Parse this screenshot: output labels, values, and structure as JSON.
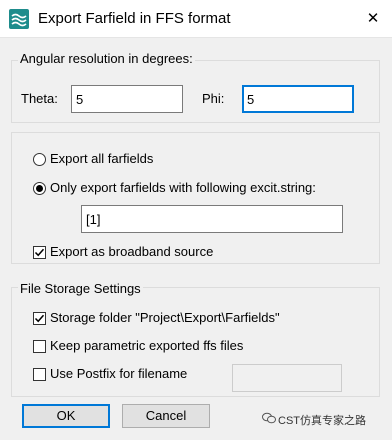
{
  "window": {
    "title": "Export Farfield in FFS format",
    "close_glyph": "✕",
    "icon": "cst-waves-icon"
  },
  "angular": {
    "group_label": "Angular resolution in degrees:",
    "theta_label": "Theta:",
    "theta_value": "5",
    "phi_label": "Phi:",
    "phi_value": "5"
  },
  "export": {
    "all_label": "Export all farfields",
    "only_label": "Only export farfields with following excit.string:",
    "excit_value": "[1]",
    "broadband_label": "Export as broadband source"
  },
  "storage": {
    "group_label": "File Storage Settings",
    "folder_label": "Storage folder \"Project\\Export\\Farfields\"",
    "keep_label": "Keep parametric exported ffs files",
    "postfix_label": "Use Postfix for filename",
    "postfix_value": ""
  },
  "buttons": {
    "ok_label": "OK",
    "cancel_label": "Cancel"
  },
  "watermark": {
    "text": "CST仿真专家之路"
  },
  "colors": {
    "accent": "#0078d7",
    "icon_bg": "#1e8c8c"
  }
}
